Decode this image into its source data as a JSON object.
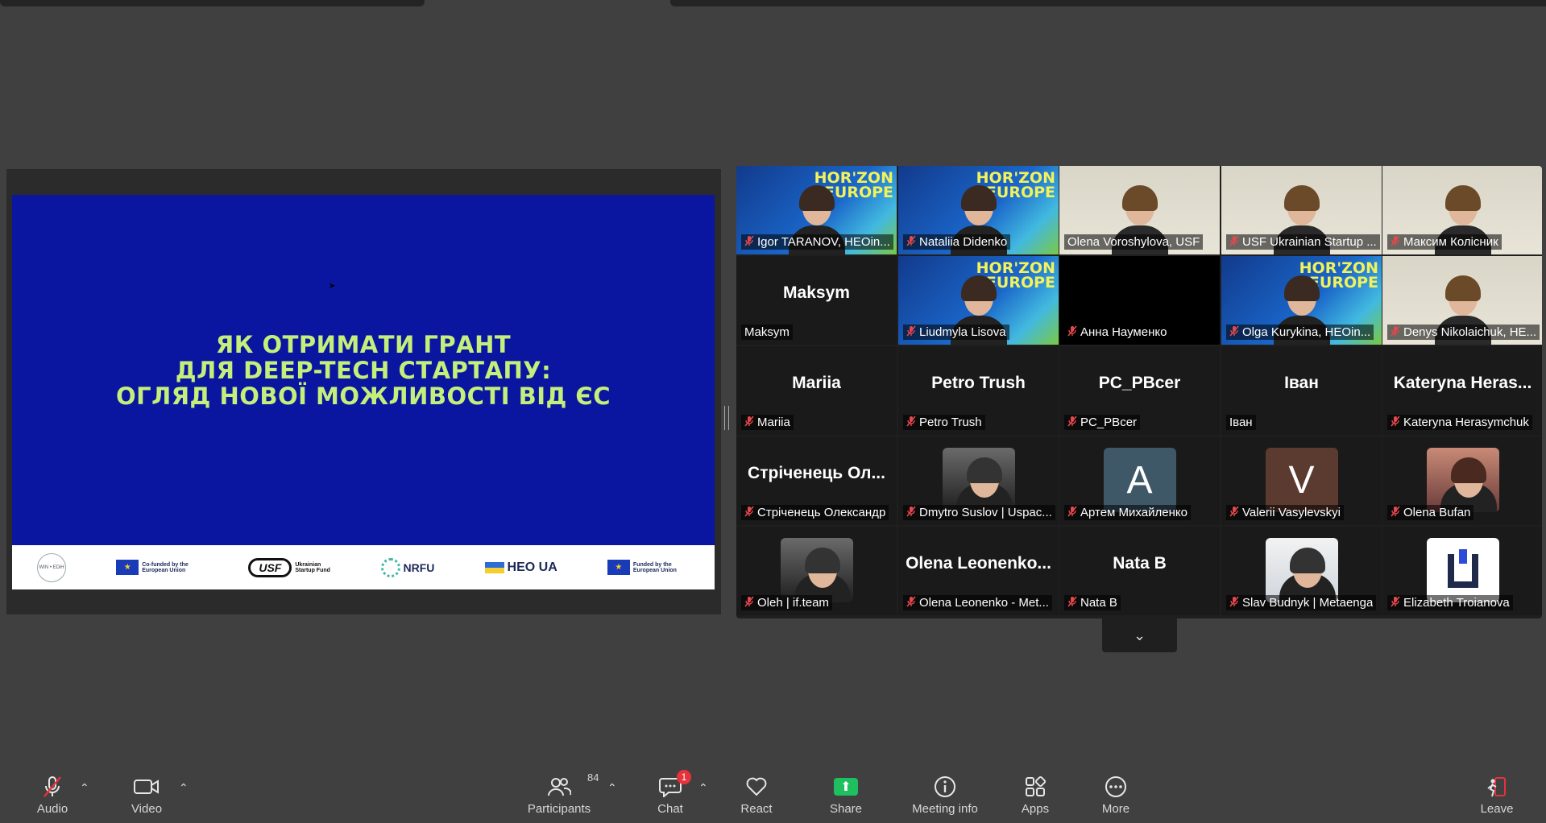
{
  "slide": {
    "title_lines": [
      "ЯК ОТРИМАТИ ГРАНТ",
      "ДЛЯ DEEP-TECH СТАРТАПУ:",
      "ОГЛЯД НОВОЇ МОЖЛИВОСТІ ВІД ЄС"
    ],
    "footer_logos": {
      "winstein": "WIN • EDiH",
      "cofunded": "Co-funded by the European Union",
      "usf": "USF",
      "usf_sub": "Ukrainian Startup Fund",
      "nrfu": "NRFU",
      "heo": "HEO UA",
      "funded": "Funded by the European Union"
    },
    "bg_color": "#0a15a0",
    "title_color": "#c4ef7a"
  },
  "participants": [
    {
      "name": "Igor TARANOV, HEOin...",
      "muted": true,
      "video": "horizon"
    },
    {
      "name": "Nataliia Didenko",
      "muted": true,
      "video": "horizon"
    },
    {
      "name": "Olena Voroshylova, USF",
      "muted": false,
      "video": "home",
      "active": true
    },
    {
      "name": "USF Ukrainian Startup ...",
      "muted": true,
      "video": "home"
    },
    {
      "name": "Максим Колісник",
      "muted": true,
      "video": "home"
    },
    {
      "name": "Maksym",
      "big": "Maksym",
      "muted": false,
      "video": "none"
    },
    {
      "name": "Liudmyla Lisova",
      "muted": true,
      "video": "horizon"
    },
    {
      "name": "Анна Науменко",
      "muted": true,
      "video": "black"
    },
    {
      "name": "Olga Kurykina, HEOin...",
      "muted": true,
      "video": "horizon"
    },
    {
      "name": "Denys Nikolaichuk, HE...",
      "muted": true,
      "video": "home"
    },
    {
      "name": "Mariia",
      "big": "Mariia",
      "muted": true,
      "video": "none"
    },
    {
      "name": "Petro Trush",
      "big": "Petro Trush",
      "muted": true,
      "video": "none"
    },
    {
      "name": "PC_PBcer",
      "big": "PC_PBcer",
      "muted": true,
      "video": "none"
    },
    {
      "name": "Іван",
      "big": "Іван",
      "muted": false,
      "video": "none"
    },
    {
      "name": "Kateryna Herasymchuk",
      "big": "Kateryna Heras...",
      "muted": true,
      "video": "none"
    },
    {
      "name": "Стріченець Олександр",
      "big": "Стріченець Ол...",
      "muted": true,
      "video": "none"
    },
    {
      "name": "Dmytro Suslov | Uspac...",
      "muted": true,
      "video": "photo-bw"
    },
    {
      "name": "Артем Михайленко",
      "muted": true,
      "video": "letter",
      "letter": "A",
      "letter_bg": "#3f5868"
    },
    {
      "name": "Valerii Vasylevskyi",
      "muted": true,
      "video": "letter",
      "letter": "V",
      "letter_bg": "#5b3a30"
    },
    {
      "name": "Olena Bufan",
      "muted": true,
      "video": "photo-color"
    },
    {
      "name": "Oleh | if.team",
      "muted": true,
      "video": "photo-bw"
    },
    {
      "name": "Olena Leonenko - Met...",
      "big": "Olena Leonenko...",
      "muted": true,
      "video": "none"
    },
    {
      "name": "Nata B",
      "big": "Nata B",
      "muted": true,
      "video": "none"
    },
    {
      "name": "Slav Budnyk | Metaenga",
      "muted": true,
      "video": "photo-light"
    },
    {
      "name": "Elizabeth Troianova",
      "muted": true,
      "video": "logo"
    }
  ],
  "horizon_text": "HOR'ZON\nEUROPE",
  "toolbar": {
    "audio": "Audio",
    "video": "Video",
    "participants": "Participants",
    "participants_count": "84",
    "chat": "Chat",
    "chat_badge": "1",
    "react": "React",
    "share": "Share",
    "meeting_info": "Meeting info",
    "apps": "Apps",
    "more": "More",
    "leave": "Leave"
  },
  "colors": {
    "active_speaker": "#2ad07a",
    "muted_icon": "#e5484d",
    "share_green": "#1dbf5e",
    "badge_red": "#e5323b"
  },
  "icons": {
    "audio": "mic-off-icon",
    "video": "camera-icon",
    "participants": "people-icon",
    "chat": "chat-bubble-icon",
    "react": "heart-icon",
    "share": "share-up-arrow-icon",
    "meeting_info": "info-icon",
    "apps": "apps-icon",
    "more": "ellipsis-icon",
    "leave": "leave-icon",
    "gallery_more": "chevron-down-icon"
  }
}
